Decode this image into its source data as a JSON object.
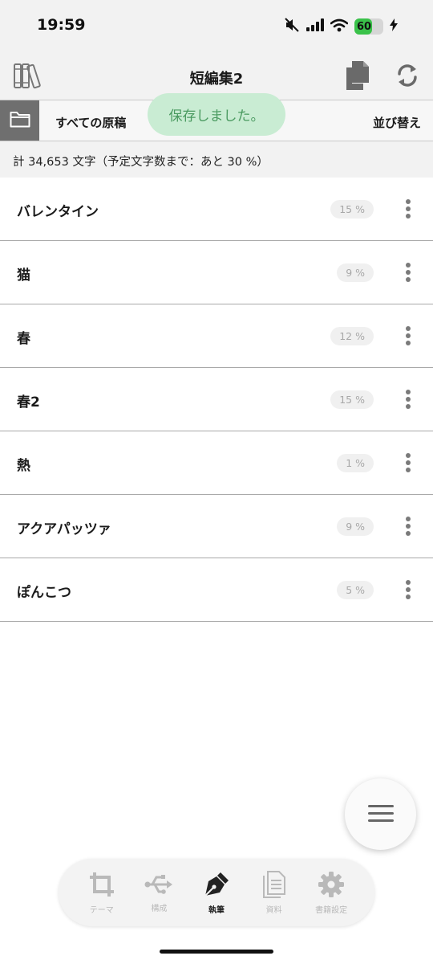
{
  "status_bar": {
    "time": "19:59",
    "battery": 60,
    "battery_label": "60"
  },
  "header": {
    "title": "短編集2"
  },
  "toolbar": {
    "all_drafts_label": "すべての原稿",
    "sort_label": "並び替え"
  },
  "toast": {
    "message": "保存しました。"
  },
  "summary": "計 34,653 文字（予定文字数まで：あと 30 %）",
  "documents": [
    {
      "title": "バレンタイン",
      "progress": "15 %"
    },
    {
      "title": "猫",
      "progress": "9 %"
    },
    {
      "title": "春",
      "progress": "12 %"
    },
    {
      "title": "春2",
      "progress": "15 %"
    },
    {
      "title": "熱",
      "progress": "1 %"
    },
    {
      "title": "アクアパッツァ",
      "progress": "9 %"
    },
    {
      "title": "ぽんこつ",
      "progress": "5 %"
    }
  ],
  "tabs": [
    {
      "label": "テーマ",
      "icon": "crop-icon",
      "active": false
    },
    {
      "label": "構成",
      "icon": "usb-icon",
      "active": false
    },
    {
      "label": "執筆",
      "icon": "pen-nib-icon",
      "active": true
    },
    {
      "label": "資料",
      "icon": "document-icon",
      "active": false
    },
    {
      "label": "書籍設定",
      "icon": "gear-icon",
      "active": false
    }
  ],
  "colors": {
    "accent_green": "#3ac24a",
    "toast_bg": "#c9ecd3",
    "toast_text": "#4a9a60",
    "folder_bg": "#6f6f6f"
  }
}
